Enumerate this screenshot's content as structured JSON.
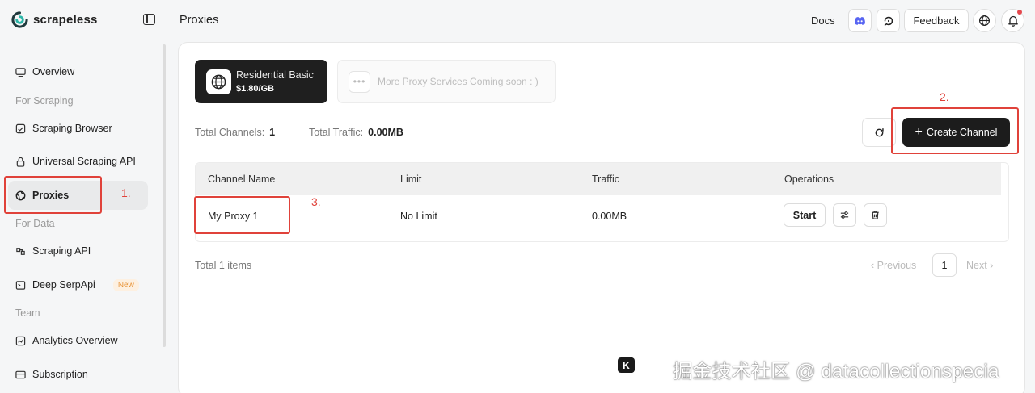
{
  "brand": {
    "name": "scrapeless"
  },
  "sidebar": {
    "items": [
      {
        "label": "Overview"
      },
      {
        "label": "Scraping Browser"
      },
      {
        "label": "Universal Scraping API"
      },
      {
        "label": "Proxies"
      },
      {
        "label": "Scraping API"
      },
      {
        "label": "Deep SerpApi",
        "badge": "New"
      },
      {
        "label": "Analytics Overview"
      },
      {
        "label": "Subscription"
      }
    ],
    "sections": [
      "For Scraping",
      "For Data",
      "Team"
    ]
  },
  "header": {
    "title": "Proxies",
    "docs": "Docs",
    "feedback": "Feedback"
  },
  "services": {
    "active": {
      "name": "Residential Basic",
      "price": "$1.80/GB"
    },
    "coming": "More Proxy Services Coming soon : )"
  },
  "stats": {
    "channels_label": "Total Channels:",
    "channels_value": "1",
    "traffic_label": "Total Traffic:",
    "traffic_value": "0.00MB"
  },
  "actions": {
    "create": "Create Channel"
  },
  "table": {
    "columns": [
      "Channel Name",
      "Limit",
      "Traffic",
      "Operations"
    ],
    "rows": [
      {
        "name": "My Proxy 1",
        "limit": "No Limit",
        "traffic": "0.00MB",
        "start": "Start"
      }
    ]
  },
  "pagination": {
    "total": "Total 1 items",
    "prev": "Previous",
    "page": "1",
    "next": "Next"
  },
  "annotations": [
    "1.",
    "2.",
    "3."
  ],
  "watermark": {
    "logo": "K",
    "text": "掘金技术社区 @ datacollectionspecia"
  },
  "colors": {
    "accent": "#1c1c1c",
    "annotation": "#e0423a",
    "new_badge": "#e8953b"
  }
}
